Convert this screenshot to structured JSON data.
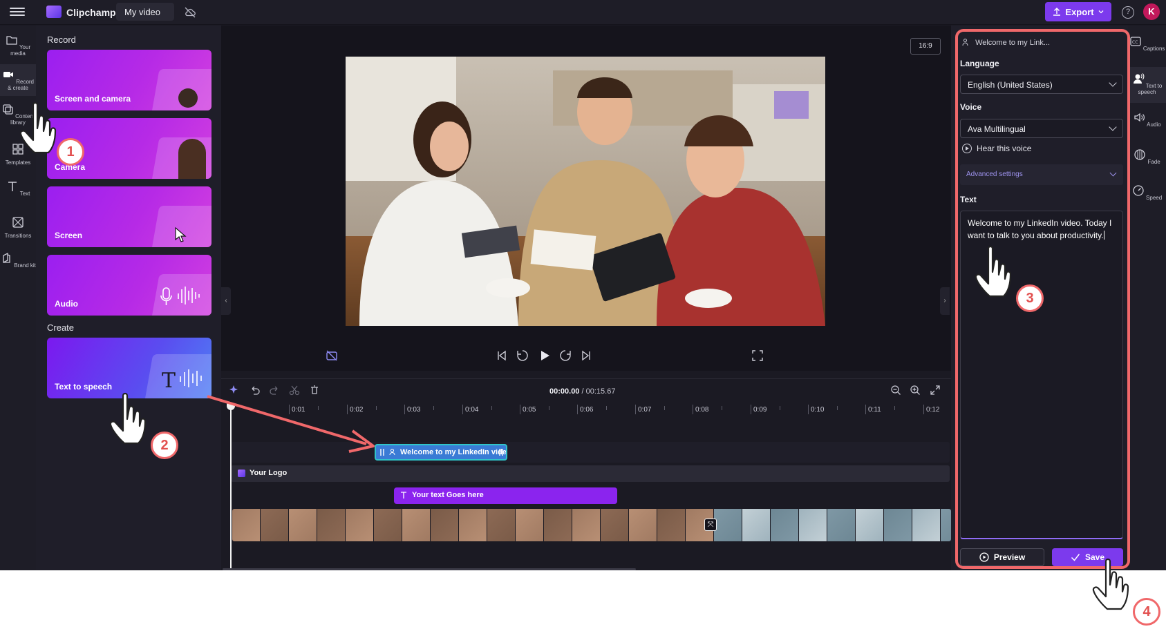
{
  "topbar": {
    "app_name": "Clipchamp",
    "project_title": "My video",
    "export_label": "Export",
    "help_glyph": "?",
    "avatar_initial": "K",
    "accent_color": "#7c3aed"
  },
  "left_rail": {
    "items": [
      {
        "label": "Your media",
        "icon": "folder-icon"
      },
      {
        "label": "Record & create",
        "icon": "video-camera-icon"
      },
      {
        "label": "Content library",
        "icon": "library-icon"
      },
      {
        "label": "Templates",
        "icon": "templates-icon"
      },
      {
        "label": "Text",
        "icon": "text-icon"
      },
      {
        "label": "Transitions",
        "icon": "transitions-icon"
      },
      {
        "label": "Brand kit",
        "icon": "brand-kit-icon"
      }
    ]
  },
  "library": {
    "record_heading": "Record",
    "create_heading": "Create",
    "cards": [
      {
        "label": "Screen and camera"
      },
      {
        "label": "Camera"
      },
      {
        "label": "Screen"
      },
      {
        "label": "Audio"
      }
    ],
    "create_card": {
      "label": "Text to speech",
      "glyph": "T"
    }
  },
  "stage": {
    "aspect_ratio": "16:9"
  },
  "timeline": {
    "current_time": "00:00.00",
    "total_time": "/ 00:15.67",
    "ticks": [
      "0:01",
      "0:02",
      "0:03",
      "0:04",
      "0:05",
      "0:06",
      "0:07",
      "0:08",
      "0:09",
      "0:10",
      "0:11",
      "0:12"
    ],
    "audio_clip_label": "Welcome to my LinkedIn vide",
    "logo_track_label": "Your Logo",
    "text_clip_label": "Your text Goes here"
  },
  "properties": {
    "header": "Welcome to my Link...",
    "language_label": "Language",
    "language_value": "English (United States)",
    "voice_label": "Voice",
    "voice_value": "Ava Multilingual",
    "hear_voice": "Hear this voice",
    "advanced_settings": "Advanced settings",
    "text_label": "Text",
    "text_value": "Welcome to my LinkedIn video. Today I want to talk to you about productivity.",
    "preview_label": "Preview",
    "save_label": "Save",
    "highlight_color": "#f0686a"
  },
  "right_rail": {
    "items": [
      {
        "label": "Captions",
        "icon": "captions-icon"
      },
      {
        "label": "Text to speech",
        "icon": "text-to-speech-icon"
      },
      {
        "label": "Audio",
        "icon": "speaker-icon"
      },
      {
        "label": "Fade",
        "icon": "fade-icon"
      },
      {
        "label": "Speed",
        "icon": "speed-icon"
      }
    ]
  },
  "annotations": {
    "steps": [
      "1",
      "2",
      "3",
      "4"
    ]
  }
}
